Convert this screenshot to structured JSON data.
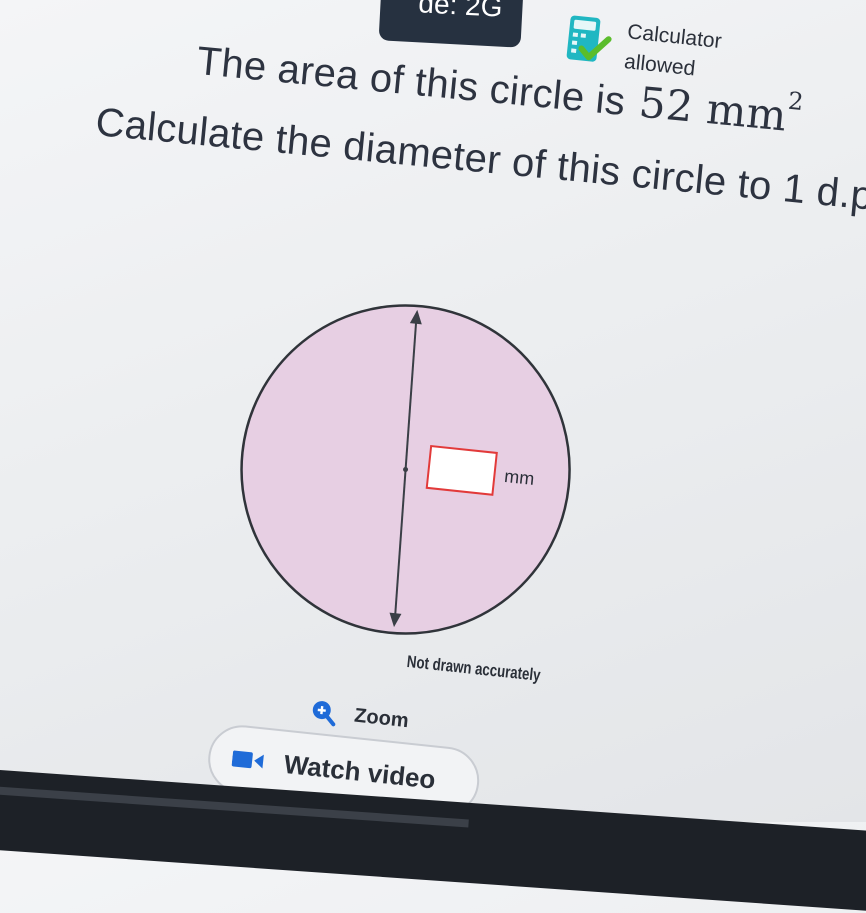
{
  "header": {
    "question_code": "de: 2G",
    "calculator": {
      "line1": "Calculator",
      "line2": "allowed",
      "icon": "calculator-check-icon"
    }
  },
  "question": {
    "line1_text": "The area of this circle is",
    "area_value": "52",
    "area_unit": "mm",
    "area_power": "2",
    "line2_text": "Calculate the diameter of this circle to 1 d.p."
  },
  "figure": {
    "answer_unit": "mm",
    "answer_value": "",
    "fill_color": "#e7cfe3",
    "answer_border_color": "#e23a3a",
    "note": "Not drawn accurately"
  },
  "controls": {
    "zoom_label": "Zoom",
    "zoom_icon": "zoom-in-icon",
    "watch_label": "Watch video",
    "watch_icon": "video-icon"
  }
}
